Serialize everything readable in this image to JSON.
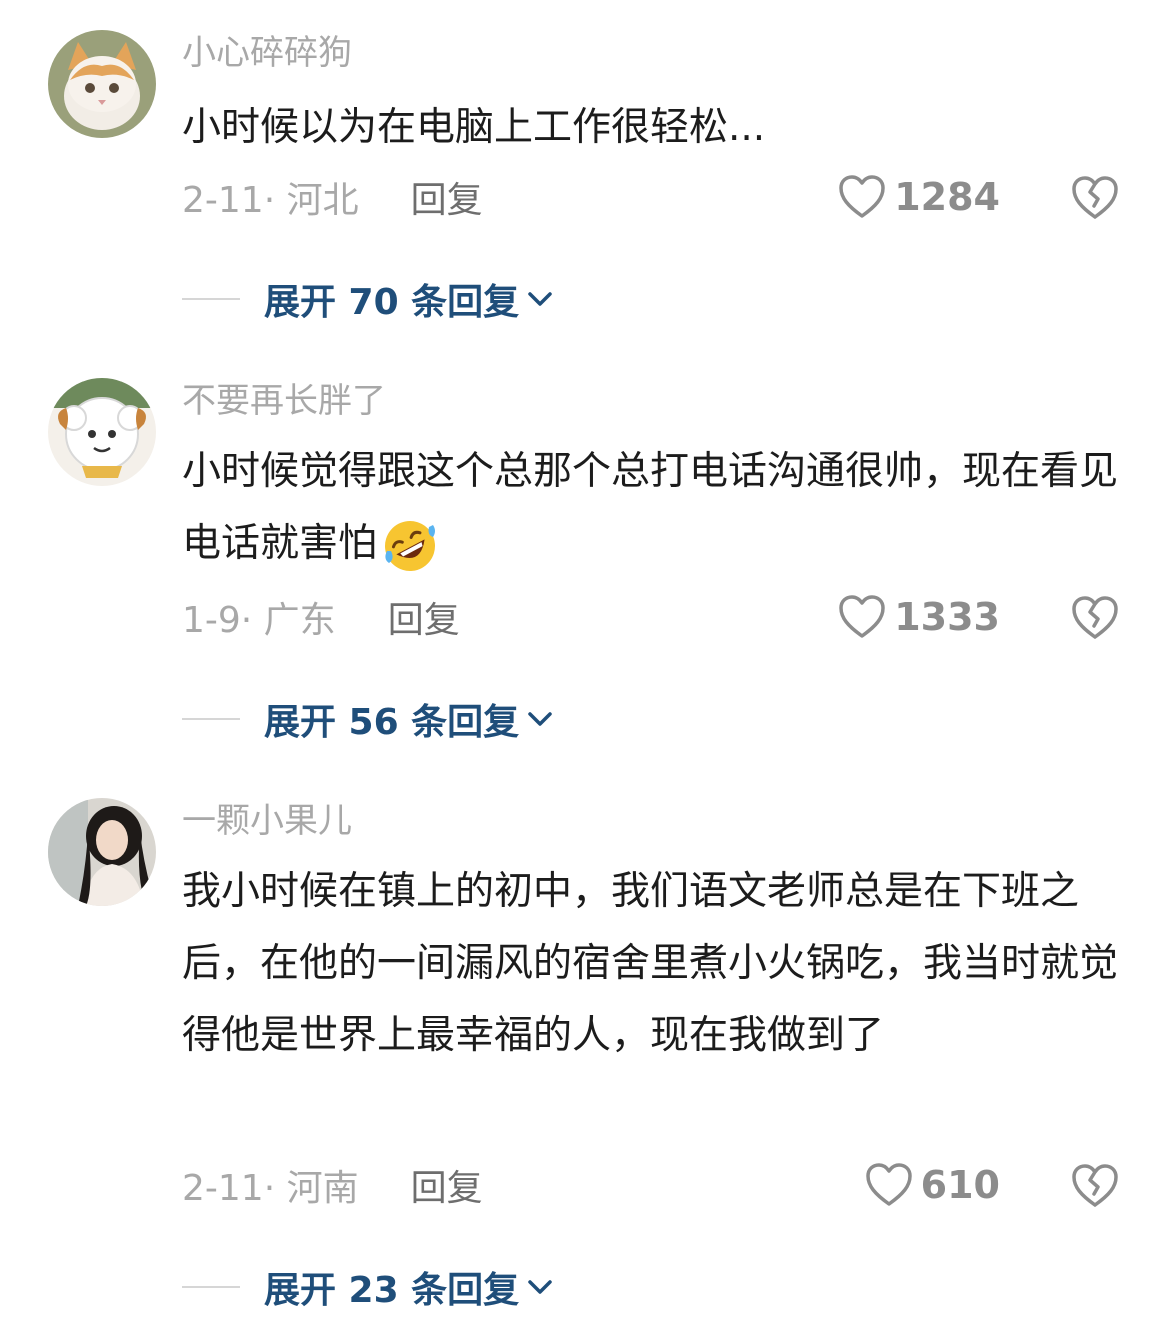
{
  "comments": [
    {
      "username": "小心碎碎狗",
      "text": "小时候以为在电脑上工作很轻松...",
      "date_location": "2-11· 河北",
      "reply_label": "回复",
      "likes": "1284",
      "expand_label": "展开 70 条回复",
      "avatar_icon": "cat-avatar"
    },
    {
      "username": "不要再长胖了",
      "text": "小时候觉得跟这个总那个总打电话沟通很帅，现在看见电话就害怕",
      "emoji": "rolling-on-floor-laughing-emoji",
      "date_location": "1-9· 广东",
      "reply_label": "回复",
      "likes": "1333",
      "expand_label": "展开 56 条回复",
      "avatar_icon": "sheep-cartoon-avatar"
    },
    {
      "username": "一颗小果儿",
      "text": "我小时候在镇上的初中，我们语文老师总是在下班之后，在他的一间漏风的宿舍里煮小火锅吃，我当时就觉得他是世界上最幸福的人，现在我做到了",
      "date_location": "2-11· 河南",
      "reply_label": "回复",
      "likes": "610",
      "expand_label": "展开 23 条回复",
      "avatar_icon": "girl-photo-avatar"
    }
  ],
  "colors": {
    "username": "#a8a8a8",
    "meta": "#a8a8a8",
    "expand_link": "#1f4e7a",
    "like_icon": "#8c8c8c"
  }
}
